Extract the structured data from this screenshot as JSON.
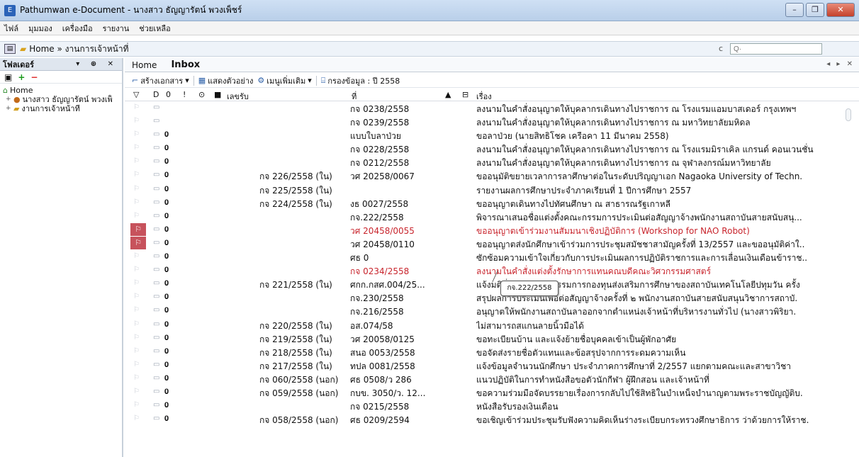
{
  "window": {
    "title": "Pathumwan e-Document - นางสาว ธัญญารัตน์ พวงเพ็ชร์",
    "minimize": "–",
    "restore": "❐",
    "close": "✕"
  },
  "menu": [
    "ไฟล์",
    "มุมมอง",
    "เครื่องมือ",
    "รายงาน",
    "ช่วยเหลือ"
  ],
  "address": {
    "path": "Home » งานการเจ้าหน้าที่",
    "search_placeholder": "Q·"
  },
  "folders_pane": {
    "title": "โฟลเดอร์",
    "controls": "▾ ⊕ ✕",
    "tree": [
      {
        "label": "Home",
        "icon": "home-icon",
        "level": 0
      },
      {
        "label": "นางสาว ธัญญารัตน์ พวงเพ็",
        "icon": "user-icon",
        "level": 1
      },
      {
        "label": "งานการเจ้าหน้าที่",
        "icon": "folder-icon",
        "level": 1
      }
    ]
  },
  "tabs": [
    {
      "label": "Home"
    },
    {
      "label": "Inbox",
      "active": true
    }
  ],
  "toolbar": {
    "new_doc": "สร้างเอกสาร",
    "preview": "แสดงตัวอย่าง",
    "more_menu": "เมนูเพิ่มเติม",
    "filter": "กรองข้อมูล : ปี 2558"
  },
  "columns": {
    "receive_no": "เลขรับ",
    "ref_no": "ที่",
    "subject": "เรื่อง"
  },
  "rows": [
    {
      "flag": false,
      "clip": false,
      "recv": "",
      "ref": "กจ 0238/2558",
      "subject": "ลงนามในคำสั่งอนุญาตให้บุคลากรเดินทางไปราชการ ณ โรงแรมแอมบาสเดอร์ กรุงเทพฯ",
      "red": false
    },
    {
      "flag": false,
      "clip": false,
      "recv": "",
      "ref": "กจ 0239/2558",
      "subject": "ลงนามในคำสั่งอนุญาตให้บุคลากรเดินทางไปราชการ ณ มหาวิทยาลัยมหิดล",
      "red": false
    },
    {
      "flag": false,
      "clip": true,
      "recv": "",
      "ref": "แบบใบลาป่วย",
      "subject": "ขอลาป่วย (นายสิทธิโชค เครือคา 11 มีนาคม 2558)",
      "red": false
    },
    {
      "flag": false,
      "clip": true,
      "recv": "",
      "ref": "กจ 0228/2558",
      "subject": "ลงนามในคำสั่งอนุญาตให้บุคลากรเดินทางไปราชการ ณ โรงแรมมิราเคิล แกรนด์ คอนเวนชั่น",
      "red": false
    },
    {
      "flag": false,
      "clip": true,
      "recv": "",
      "ref": "กจ 0212/2558",
      "subject": "ลงนามในคำสั่งอนุญาตให้บุคลากรเดินทางไปราชการ ณ จุฬาลงกรณ์มหาวิทยาลัย",
      "red": false
    },
    {
      "flag": false,
      "clip": true,
      "recv": "กจ 226/2558 (ใน)",
      "ref": "วศ 20258/0067",
      "subject": "ขออนุมัติขยายเวลาการลาศึกษาต่อในระดับปริญญาเอก Nagaoka University of Techn.",
      "red": false
    },
    {
      "flag": false,
      "clip": true,
      "recv": "กจ 225/2558 (ใน)",
      "ref": "",
      "subject": "รายงานผลการศึกษาประจำภาคเรียนที่ 1 ปีการศึกษา 2557",
      "red": false
    },
    {
      "flag": false,
      "clip": true,
      "recv": "กจ 224/2558 (ใน)",
      "ref": "งธ 0027/2558",
      "subject": "ขออนุญาตเดินทางไปทัศนศึกษา ณ สาธารณรัฐเกาหลี",
      "red": false
    },
    {
      "flag": false,
      "clip": true,
      "recv": "",
      "ref": "กจ.222/2558",
      "subject": "พิจารณาเสนอชื่อแต่งตั้งคณะกรรมการประเมินต่อสัญญาจ้างพนักงานสถาบันสายสนับสนุ...",
      "red": false
    },
    {
      "flag": true,
      "clip": true,
      "recv": "",
      "ref": "วศ 20458/0055",
      "subject": "ขออนุญาตเข้าร่วมงานสัมมนาเชิงปฏิบัติการ (Workshop for NAO Robot)",
      "red": true
    },
    {
      "flag": true,
      "clip": true,
      "recv": "",
      "ref": "วศ 20458/0110",
      "subject": "ขออนุญาตส่งนักศึกษาเข้าร่วมการประชุมสมัชชาสามัญครั้งที่ 13/2557 และขออนุมัติค่าใ..",
      "red": false
    },
    {
      "flag": false,
      "clip": true,
      "recv": "",
      "ref": "ศธ 0",
      "subject": "ซักซ้อมความเข้าใจเกี่ยวกับการประเมินผลการปฏิบัติราชการและการเลื่อนเงินเดือนข้าราช..",
      "red": false
    },
    {
      "flag": false,
      "clip": true,
      "recv": "",
      "ref": "กจ 0234/2558",
      "subject": "ลงนามในคำสั่งแต่งตั้งรักษาการแทนคณบดีคณะวิศวกรรมศาสตร์",
      "red": true
    },
    {
      "flag": false,
      "clip": true,
      "recv": "กจ 221/2558 (ใน)",
      "ref": "ศกก.กสศ.004/25...",
      "subject": "แจ้งมติที่ประชุมคณะกรรมการกองทุนส่งเสริมการศึกษาของสถาบันเทคโนโลยีปทุมวัน ครั้ง",
      "red": false
    },
    {
      "flag": false,
      "clip": true,
      "recv": "",
      "ref": "กจ.230/2558",
      "subject": "สรุปผลการประเมินเพื่อต่อสัญญาจ้างครั้งที่ ๒ พนักงานสถาบันสายสนับสนุนวิชาการสถาบั.",
      "red": false
    },
    {
      "flag": false,
      "clip": true,
      "recv": "",
      "ref": "กจ.216/2558",
      "subject": "อนุญาตให้พนักงานสถาบันลาออกจากตำแหน่งเจ้าหน้าที่บริหารงานทั่วไป (นางสาวพิริยา.",
      "red": false
    },
    {
      "flag": false,
      "clip": true,
      "recv": "กจ 220/2558 (ใน)",
      "ref": "อส.074/58",
      "subject": "ไม่สามารถสแกนลายนิ้วมือได้",
      "red": false
    },
    {
      "flag": false,
      "clip": true,
      "recv": "กจ 219/2558 (ใน)",
      "ref": "วศ 20058/0125",
      "subject": "ขอทะเบียนบ้าน และแจ้งย้ายชื่อบุคคลเข้าเป็นผู้พักอาศัย",
      "red": false
    },
    {
      "flag": false,
      "clip": true,
      "recv": "กจ 218/2558 (ใน)",
      "ref": "สนอ 0053/2558",
      "subject": "ขอจัดส่งรายชื่อตัวแทนและข้อสรุปจากการระดมความเห็น",
      "red": false
    },
    {
      "flag": false,
      "clip": true,
      "recv": "กจ 217/2558 (ใน)",
      "ref": "ทปล 0081/2558",
      "subject": "แจ้งข้อมูลจำนวนนักศึกษา ประจำภาคการศึกษาที่ 2/2557 แยกตามคณะและสาขาวิชา",
      "red": false
    },
    {
      "flag": false,
      "clip": true,
      "recv": "กจ 060/2558 (นอก)",
      "ref": "ศธ 0508/ว 286",
      "subject": "แนวปฏิบัติในการทำหนังสือขอตัวนักกีฬา ผู้ฝึกสอน และเจ้าหน้าที่",
      "red": false
    },
    {
      "flag": false,
      "clip": true,
      "recv": "กจ 059/2558 (นอก)",
      "ref": "กบข. 3050/ว. 12...",
      "subject": "ขอความร่วมมือจัดบรรยายเรื่องการกลับไปใช้สิทธิในบำเหน็จบำนาญตามพระราชบัญญัติบ.",
      "red": false
    },
    {
      "flag": false,
      "clip": true,
      "recv": "",
      "ref": "กจ 0215/2558",
      "subject": "หนังสือรับรองเงินเดือน",
      "red": false
    },
    {
      "flag": false,
      "clip": true,
      "recv": "กจ 058/2558 (นอก)",
      "ref": "ศธ 0209/2594",
      "subject": "ขอเชิญเข้าร่วมประชุมรับฟังความคิดเห็นร่างระเบียบกระทรวงศึกษาธิการ ว่าด้วยการให้ราช.",
      "red": false
    }
  ],
  "tooltip": "กจ.222/2558",
  "glyphs": {
    "flag": "⚐",
    "doc": "▭",
    "clip": "𝟎",
    "excl": "!",
    "flag_head": "▽",
    "doc_head": "D",
    "clip_head": "0",
    "imp_head": "!",
    "watch_head": "⊙",
    "tag_head": "■",
    "lock_head": "🔒",
    "box_head": "⊟"
  }
}
